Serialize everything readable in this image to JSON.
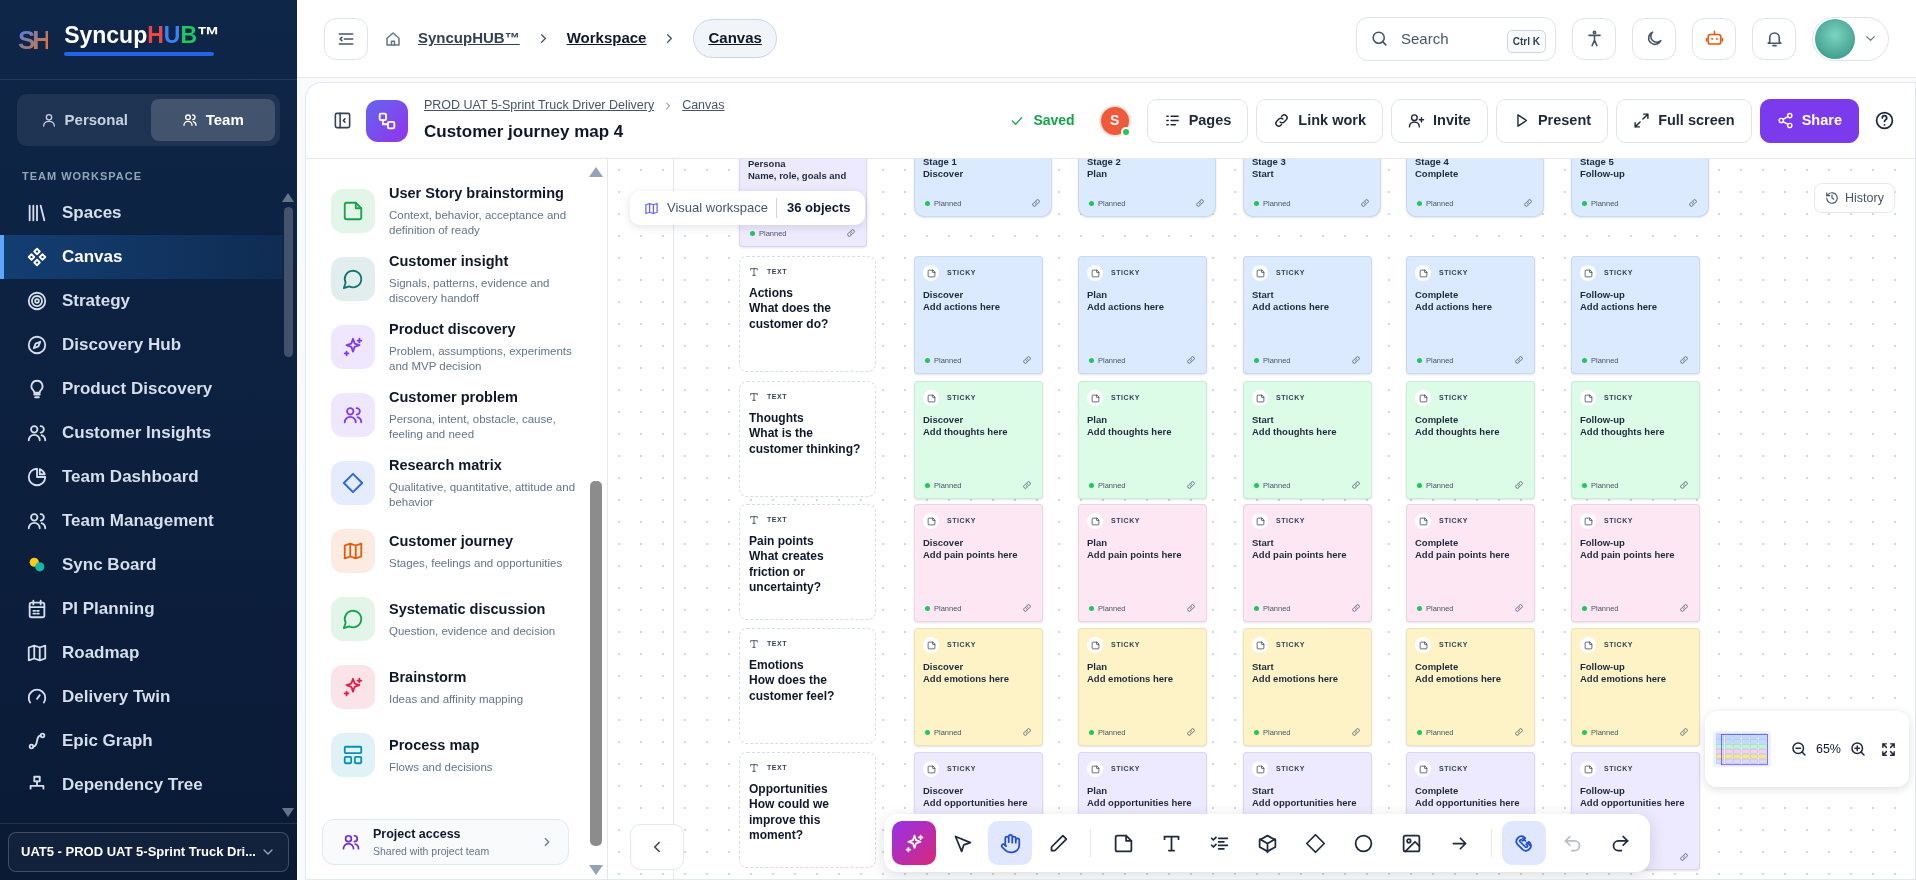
{
  "sidebar": {
    "logo": {
      "mark": "SH",
      "name": "Syncup",
      "highlight": "HUB",
      "trademark": "™"
    },
    "scope_tabs": [
      {
        "label": "Personal",
        "selected": false
      },
      {
        "label": "Team",
        "selected": true
      }
    ],
    "section_title": "TEAM WORKSPACE",
    "items": [
      {
        "label": "Spaces",
        "selected": false
      },
      {
        "label": "Canvas",
        "selected": true
      },
      {
        "label": "Strategy",
        "selected": false
      },
      {
        "label": "Discovery Hub",
        "selected": false
      },
      {
        "label": "Product Discovery",
        "selected": false
      },
      {
        "label": "Customer Insights",
        "selected": false
      },
      {
        "label": "Team Dashboard",
        "selected": false
      },
      {
        "label": "Team Management",
        "selected": false
      },
      {
        "label": "Sync Board",
        "selected": false
      },
      {
        "label": "PI Planning",
        "selected": false
      },
      {
        "label": "Roadmap",
        "selected": false
      },
      {
        "label": "Delivery Twin",
        "selected": false
      },
      {
        "label": "Epic Graph",
        "selected": false
      },
      {
        "label": "Dependency Tree",
        "selected": false
      }
    ],
    "project_selector": "UAT5 - PROD UAT 5-Sprint Truck Dri..."
  },
  "topbar": {
    "breadcrumb": [
      {
        "label": "SyncupHUB™",
        "selected": false
      },
      {
        "label": "Workspace",
        "selected": false
      },
      {
        "label": "Canvas",
        "selected": true
      }
    ],
    "search": {
      "placeholder": "Search",
      "shortcut": "Ctrl K"
    }
  },
  "header": {
    "breadcrumb": [
      "PROD UAT 5-Sprint Truck Driver Delivery",
      "Canvas"
    ],
    "title": "Customer journey map 4",
    "save_status": "Saved",
    "collaborator": {
      "initial": "S",
      "online": true
    },
    "actions": [
      {
        "label": "Pages",
        "kind": "default"
      },
      {
        "label": "Link work",
        "kind": "default"
      },
      {
        "label": "Invite",
        "kind": "default"
      },
      {
        "label": "Present",
        "kind": "default"
      },
      {
        "label": "Full screen",
        "kind": "default"
      },
      {
        "label": "Share",
        "kind": "primary"
      }
    ]
  },
  "templates": {
    "items": [
      {
        "title": "User Story brainstorming",
        "description": "Context, behavior, acceptance and definition of ready",
        "color": "#16a34a"
      },
      {
        "title": "Customer insight",
        "description": "Signals, patterns, evidence and discovery handoff",
        "color": "#0f766e"
      },
      {
        "title": "Product discovery",
        "description": "Problem, assumptions, experiments and MVP decision",
        "color": "#7c3aed"
      },
      {
        "title": "Customer problem",
        "description": "Persona, intent, obstacle, cause, feeling and need",
        "color": "#7c3aed"
      },
      {
        "title": "Research matrix",
        "description": "Qualitative, quantitative, attitude and behavior",
        "color": "#2563eb"
      },
      {
        "title": "Customer journey",
        "description": "Stages, feelings and opportunities",
        "color": "#ea580c"
      },
      {
        "title": "Systematic discussion",
        "description": "Question, evidence and decision",
        "color": "#16a34a"
      },
      {
        "title": "Brainstorm",
        "description": "Ideas and affinity mapping",
        "color": "#e11d48"
      },
      {
        "title": "Process map",
        "description": "Flows and decisions",
        "color": "#0891b2"
      }
    ],
    "footer": {
      "title": "Project access",
      "subtitle": "Shared with project team"
    }
  },
  "canvas": {
    "workspace_label": "Visual workspace",
    "object_count": "36 objects",
    "history_label": "History",
    "persona": {
      "title": "Persona",
      "subtitle": "Name, role, goals and",
      "status": "Planned"
    },
    "stages": [
      {
        "label": "Stage 1",
        "name": "Discover",
        "status": "Planned"
      },
      {
        "label": "Stage 2",
        "name": "Plan",
        "status": "Planned"
      },
      {
        "label": "Stage 3",
        "name": "Start",
        "status": "Planned"
      },
      {
        "label": "Stage 4",
        "name": "Complete",
        "status": "Planned"
      },
      {
        "label": "Stage 5",
        "name": "Follow-up",
        "status": "Planned"
      }
    ],
    "rows": [
      {
        "type_label": "TEXT",
        "title": "Actions",
        "question": "What does the customer do?",
        "color": "#dbeafe",
        "cards": [
          {
            "type_label": "STICKY",
            "title": "Discover",
            "body": "Add actions here",
            "status": "Planned"
          },
          {
            "type_label": "STICKY",
            "title": "Plan",
            "body": "Add actions here",
            "status": "Planned"
          },
          {
            "type_label": "STICKY",
            "title": "Start",
            "body": "Add actions here",
            "status": "Planned"
          },
          {
            "type_label": "STICKY",
            "title": "Complete",
            "body": "Add actions here",
            "status": "Planned"
          },
          {
            "type_label": "STICKY",
            "title": "Follow-up",
            "body": "Add actions here",
            "status": "Planned"
          }
        ]
      },
      {
        "type_label": "TEXT",
        "title": "Thoughts",
        "question": "What is the customer thinking?",
        "color": "#dcfce7",
        "cards": [
          {
            "type_label": "STICKY",
            "title": "Discover",
            "body": "Add thoughts here",
            "status": "Planned"
          },
          {
            "type_label": "STICKY",
            "title": "Plan",
            "body": "Add thoughts here",
            "status": "Planned"
          },
          {
            "type_label": "STICKY",
            "title": "Start",
            "body": "Add thoughts here",
            "status": "Planned"
          },
          {
            "type_label": "STICKY",
            "title": "Complete",
            "body": "Add thoughts here",
            "status": "Planned"
          },
          {
            "type_label": "STICKY",
            "title": "Follow-up",
            "body": "Add thoughts here",
            "status": "Planned"
          }
        ]
      },
      {
        "type_label": "TEXT",
        "title": "Pain points",
        "question": "What creates friction or uncertainty?",
        "color": "#fce7f3",
        "cards": [
          {
            "type_label": "STICKY",
            "title": "Discover",
            "body": "Add pain points here",
            "status": "Planned"
          },
          {
            "type_label": "STICKY",
            "title": "Plan",
            "body": "Add pain points here",
            "status": "Planned"
          },
          {
            "type_label": "STICKY",
            "title": "Start",
            "body": "Add pain points here",
            "status": "Planned"
          },
          {
            "type_label": "STICKY",
            "title": "Complete",
            "body": "Add pain points here",
            "status": "Planned"
          },
          {
            "type_label": "STICKY",
            "title": "Follow-up",
            "body": "Add pain points here",
            "status": "Planned"
          }
        ]
      },
      {
        "type_label": "TEXT",
        "title": "Emotions",
        "question": "How does the customer feel?",
        "color": "#fef3c7",
        "cards": [
          {
            "type_label": "STICKY",
            "title": "Discover",
            "body": "Add emotions here",
            "status": "Planned"
          },
          {
            "type_label": "STICKY",
            "title": "Plan",
            "body": "Add emotions here",
            "status": "Planned"
          },
          {
            "type_label": "STICKY",
            "title": "Start",
            "body": "Add emotions here",
            "status": "Planned"
          },
          {
            "type_label": "STICKY",
            "title": "Complete",
            "body": "Add emotions here",
            "status": "Planned"
          },
          {
            "type_label": "STICKY",
            "title": "Follow-up",
            "body": "Add emotions here",
            "status": "Planned"
          }
        ]
      },
      {
        "type_label": "TEXT",
        "title": "Opportunities",
        "question": "How could we improve this moment?",
        "color": "#ede9fe",
        "cards": [
          {
            "type_label": "STICKY",
            "title": "Discover",
            "body": "Add opportunities here"
          },
          {
            "type_label": "STICKY",
            "title": "Plan",
            "body": "Add opportunities here"
          },
          {
            "type_label": "STICKY",
            "title": "Start",
            "body": "Add opportunities here"
          },
          {
            "type_label": "STICKY",
            "title": "Complete",
            "body": "Add opportunities here"
          },
          {
            "type_label": "STICKY",
            "title": "Follow-up",
            "body": "Add opportunities here"
          }
        ]
      }
    ],
    "toolbar": [
      [
        {
          "kind": "ai",
          "selected": false,
          "disabled": false
        },
        {
          "kind": "tool",
          "selected": false,
          "disabled": false
        },
        {
          "kind": "tool",
          "selected": true,
          "disabled": false
        },
        {
          "kind": "tool",
          "selected": false,
          "disabled": false
        }
      ],
      [
        {
          "kind": "tool",
          "selected": false,
          "disabled": false
        },
        {
          "kind": "tool",
          "selected": false,
          "disabled": false
        },
        {
          "kind": "tool",
          "selected": false,
          "disabled": false
        },
        {
          "kind": "tool",
          "selected": false,
          "disabled": false
        },
        {
          "kind": "tool",
          "selected": false,
          "disabled": false
        },
        {
          "kind": "tool",
          "selected": false,
          "disabled": false
        },
        {
          "kind": "tool",
          "selected": false,
          "disabled": false
        },
        {
          "kind": "tool",
          "selected": false,
          "disabled": false
        }
      ],
      [
        {
          "kind": "tool",
          "selected": true,
          "disabled": false
        },
        {
          "kind": "tool",
          "selected": false,
          "disabled": true
        },
        {
          "kind": "tool",
          "selected": false,
          "disabled": false
        }
      ]
    ],
    "zoom": "65%"
  }
}
